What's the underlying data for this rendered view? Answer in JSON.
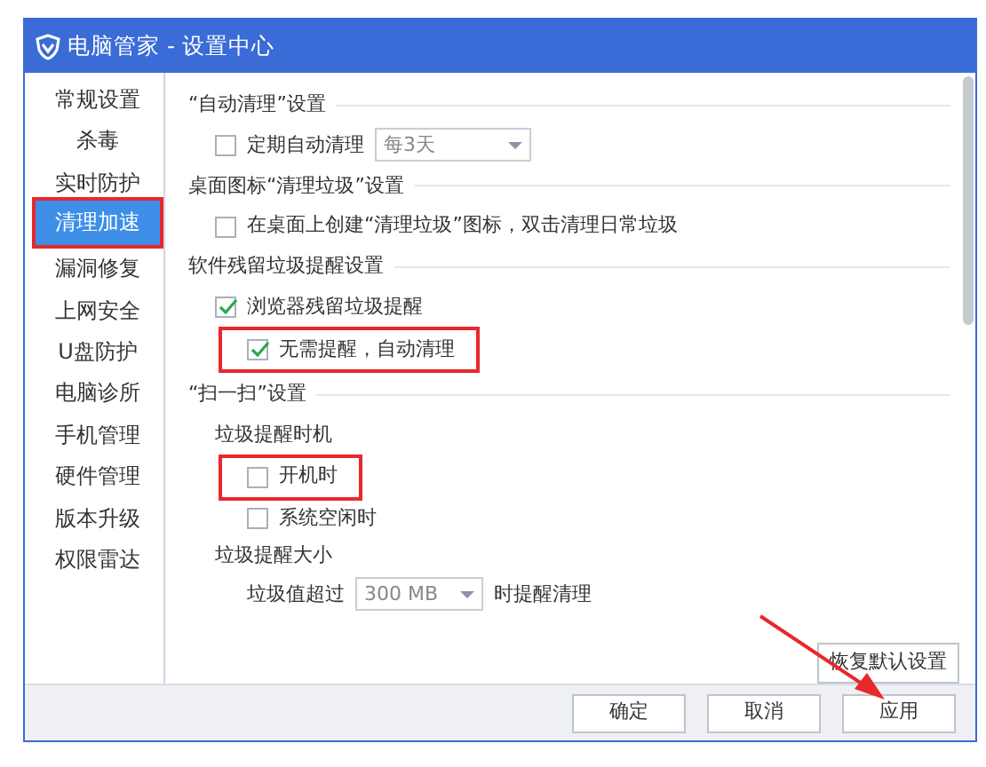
{
  "window": {
    "title": "电脑管家 - 设置中心"
  },
  "sidebar": {
    "items": [
      {
        "label": "常规设置",
        "selected": false,
        "highlighted": false
      },
      {
        "label": "杀毒",
        "selected": false,
        "highlighted": false
      },
      {
        "label": "实时防护",
        "selected": false,
        "highlighted": false
      },
      {
        "label": "清理加速",
        "selected": true,
        "highlighted": true
      },
      {
        "label": "漏洞修复",
        "selected": false,
        "highlighted": false
      },
      {
        "label": "上网安全",
        "selected": false,
        "highlighted": false
      },
      {
        "label": "U盘防护",
        "selected": false,
        "highlighted": false
      },
      {
        "label": "电脑诊所",
        "selected": false,
        "highlighted": false
      },
      {
        "label": "手机管理",
        "selected": false,
        "highlighted": false
      },
      {
        "label": "硬件管理",
        "selected": false,
        "highlighted": false
      },
      {
        "label": "版本升级",
        "selected": false,
        "highlighted": false
      },
      {
        "label": "权限雷达",
        "selected": false,
        "highlighted": false
      }
    ]
  },
  "sections": [
    {
      "title": "“自动清理”设置",
      "rows": [
        {
          "kind": "checkbox",
          "label": "定期自动清理",
          "checked": false,
          "highlighted": false,
          "select": {
            "value": "每3天"
          }
        }
      ]
    },
    {
      "title": "桌面图标“清理垃圾”设置",
      "rows": [
        {
          "kind": "checkbox",
          "label": "在桌面上创建“清理垃圾”图标，双击清理日常垃圾",
          "checked": false,
          "highlighted": false
        }
      ]
    },
    {
      "title": "软件残留垃圾提醒设置",
      "rows": [
        {
          "kind": "checkbox",
          "label": "浏览器残留垃圾提醒",
          "checked": true,
          "highlighted": false,
          "children": [
            {
              "kind": "checkbox",
              "label": "无需提醒，自动清理",
              "checked": true,
              "highlighted": true
            }
          ]
        }
      ]
    },
    {
      "title": "“扫一扫”设置",
      "rows": [
        {
          "kind": "subheading",
          "label": "垃圾提醒时机",
          "children": [
            {
              "kind": "checkbox",
              "label": "开机时",
              "checked": false,
              "highlighted": true
            },
            {
              "kind": "checkbox",
              "label": "系统空闲时",
              "checked": false,
              "highlighted": false
            }
          ]
        },
        {
          "kind": "subheading",
          "label": "垃圾提醒大小",
          "children": [
            {
              "kind": "field",
              "label_before": "垃圾值超过",
              "select": {
                "value": "300 MB"
              },
              "label_after": "时提醒清理"
            }
          ]
        }
      ]
    }
  ],
  "reset_button": "恢复默认设置",
  "buttons": [
    "确定",
    "取消",
    "应用"
  ]
}
